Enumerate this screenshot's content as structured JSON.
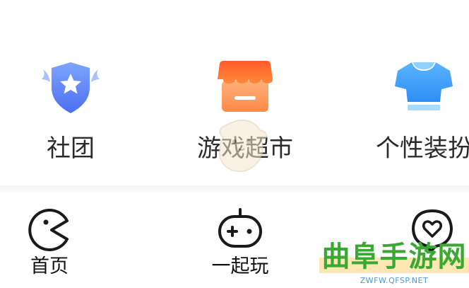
{
  "features": [
    {
      "label": "社团",
      "icon": "shield-star-icon",
      "color": "#5b86f5"
    },
    {
      "label": "游戏超市",
      "icon": "store-awning-icon",
      "color": "#ff7a2e"
    },
    {
      "label": "个性装扮",
      "icon": "tshirt-icon",
      "color": "#3aa0f5"
    }
  ],
  "tabs": [
    {
      "label": "首页",
      "icon": "pacman-icon"
    },
    {
      "label": "一起玩",
      "icon": "gamepad-icon"
    },
    {
      "label": "",
      "icon": "heart-chat-icon"
    }
  ],
  "watermark": {
    "title": "曲阜手游网",
    "url": "ZWFW.QFSP.NET"
  },
  "colors": {
    "text": "#2b2b2b",
    "tab_text": "#111111",
    "watermark_green": "#3aa832",
    "watermark_blue": "#4a9ad4"
  }
}
